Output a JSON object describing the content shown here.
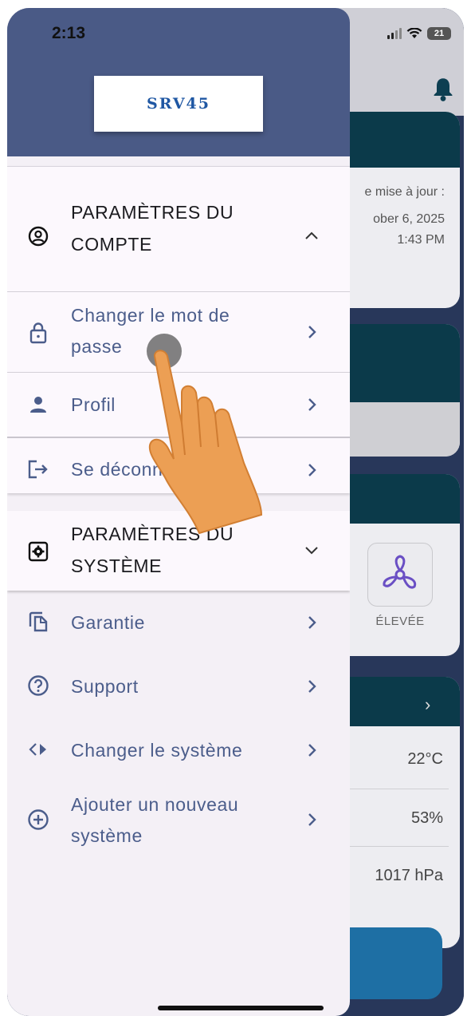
{
  "status_bar": {
    "time": "2:13",
    "battery": "21"
  },
  "drawer": {
    "logo_text": "SRV45",
    "account_section": {
      "title": "PARAMÈTRES DU COMPTE",
      "title_line1": "PARAMÈTRES DU",
      "title_line2": "COMPTE",
      "items": [
        {
          "label_line1": "Changer le mot de",
          "label_line2": "passe",
          "icon": "lock-icon"
        },
        {
          "label": "Profil",
          "icon": "person-icon"
        },
        {
          "label": "Se déconnecter",
          "icon": "logout-icon"
        }
      ]
    },
    "system_section": {
      "title_line1": "PARAMÈTRES DU",
      "title_line2": "SYSTÈME"
    },
    "items": [
      {
        "label": "Garantie",
        "icon": "copy-icon"
      },
      {
        "label": "Support",
        "icon": "help-circle-icon"
      },
      {
        "label": "Changer le système",
        "icon": "swap-arrows-icon"
      },
      {
        "label_line1": "Ajouter un nouveau",
        "label_line2": "système",
        "icon": "add-circle-icon"
      }
    ]
  },
  "background": {
    "last_update_label": "e mise à jour :",
    "last_update_date": "ober 6, 2025",
    "last_update_time": "1:43 PM",
    "fan_speed": "ÉLEVÉE",
    "temperature": "22°C",
    "humidity": "53%",
    "pressure": "1017 hPa"
  },
  "colors": {
    "drawer_header": "#4a5a86",
    "accent_text": "#4b5d8b",
    "logo_blue": "#1f57a3",
    "card_cap": "#0b3a4a",
    "fan_purple": "#6a4fc4"
  }
}
